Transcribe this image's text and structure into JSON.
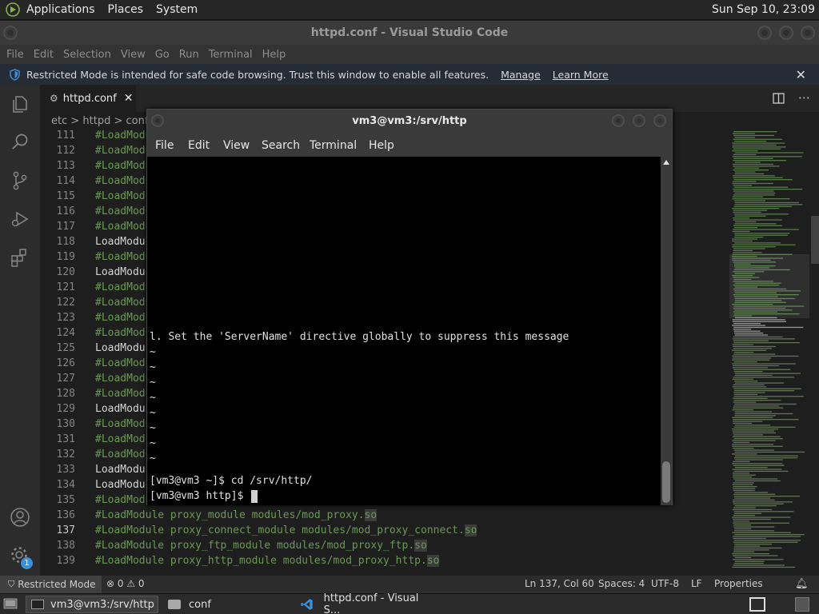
{
  "top_panel": {
    "menus": [
      "Applications",
      "Places",
      "System"
    ],
    "clock": "Sun Sep 10, 23:09"
  },
  "vscode": {
    "window_title": "httpd.conf - Visual Studio Code",
    "menu": [
      "File",
      "Edit",
      "Selection",
      "View",
      "Go",
      "Run",
      "Terminal",
      "Help"
    ],
    "banner": {
      "message": "Restricted Mode is intended for safe code browsing. Trust this window to enable all features.",
      "manage": "Manage",
      "learn_more": "Learn More",
      "close": "✕"
    },
    "tab": {
      "label": "httpd.conf",
      "close": "✕"
    },
    "breadcrumb": "etc > httpd > conf >",
    "lines": [
      {
        "n": "111",
        "text": "#LoadModu",
        "type": "cm"
      },
      {
        "n": "112",
        "text": "#LoadModu",
        "type": "cm"
      },
      {
        "n": "113",
        "text": "#LoadModu",
        "type": "cm"
      },
      {
        "n": "114",
        "text": "#LoadModu",
        "type": "cm"
      },
      {
        "n": "115",
        "text": "#LoadModu",
        "type": "cm"
      },
      {
        "n": "116",
        "text": "#LoadModu",
        "type": "cm"
      },
      {
        "n": "117",
        "text": "#LoadModu",
        "type": "cm"
      },
      {
        "n": "118",
        "text": "LoadModu",
        "type": "kw"
      },
      {
        "n": "119",
        "text": "#LoadModu",
        "type": "cm"
      },
      {
        "n": "120",
        "text": "LoadModu",
        "type": "kw"
      },
      {
        "n": "121",
        "text": "#LoadModu",
        "type": "cm"
      },
      {
        "n": "122",
        "text": "#LoadModu",
        "type": "cm"
      },
      {
        "n": "123",
        "text": "#LoadModu",
        "type": "cm"
      },
      {
        "n": "124",
        "text": "#LoadModu",
        "type": "cm"
      },
      {
        "n": "125",
        "text": "LoadModu",
        "type": "kw"
      },
      {
        "n": "126",
        "text": "#LoadModu",
        "type": "cm"
      },
      {
        "n": "127",
        "text": "#LoadModu",
        "type": "cm"
      },
      {
        "n": "128",
        "text": "#LoadModu",
        "type": "cm"
      },
      {
        "n": "129",
        "text": "LoadModu",
        "type": "kw"
      },
      {
        "n": "130",
        "text": "#LoadModu",
        "type": "cm"
      },
      {
        "n": "131",
        "text": "#LoadModu",
        "type": "cm"
      },
      {
        "n": "132",
        "text": "#LoadModu",
        "type": "cm"
      },
      {
        "n": "133",
        "text": "LoadModu",
        "type": "kw"
      },
      {
        "n": "134",
        "text": "LoadModu",
        "type": "kw"
      },
      {
        "n": "135",
        "text": "#LoadModu",
        "type": "cm"
      },
      {
        "n": "136",
        "text": "#LoadModule proxy_module modules/mod_proxy.",
        "so": "so",
        "type": "cm"
      },
      {
        "n": "137",
        "text": "#LoadModule proxy_connect_module modules/mod_proxy_connect.",
        "so": "so",
        "type": "cm",
        "active": true
      },
      {
        "n": "138",
        "text": "#LoadModule proxy_ftp_module modules/mod_proxy_ftp.",
        "so": "so",
        "type": "cm"
      },
      {
        "n": "139",
        "text": "#LoadModule proxy_http_module modules/mod_proxy_http.",
        "so": "so",
        "type": "cm"
      }
    ],
    "status": {
      "restricted": "Restricted Mode",
      "problems": "⊗ 0 ⚠ 0",
      "position": "Ln 137, Col 60",
      "spaces": "Spaces: 4",
      "encoding": "UTF-8",
      "eol": "LF",
      "language": "Properties",
      "badge": "1"
    }
  },
  "terminal": {
    "title": "vm3@vm3:/srv/http",
    "menu": [
      "File",
      "Edit",
      "View",
      "Search",
      "Terminal",
      "Help"
    ],
    "lines": [
      "l. Set the 'ServerName' directive globally to suppress this message",
      "~",
      "~",
      "~",
      "~",
      "~",
      "~",
      "~",
      "~"
    ],
    "prompt1": "[vm3@vm3 ~]$ cd /srv/http/",
    "prompt2": "[vm3@vm3 http]$"
  },
  "taskbar": {
    "items": [
      "vm3@vm3:/srv/http",
      "conf",
      "httpd.conf - Visual S..."
    ]
  },
  "colors": {
    "comment": "#6a9955",
    "editor_bg": "#1e1e1e",
    "banner_bg": "#262c36",
    "accent_blue": "#3c8fd9"
  }
}
